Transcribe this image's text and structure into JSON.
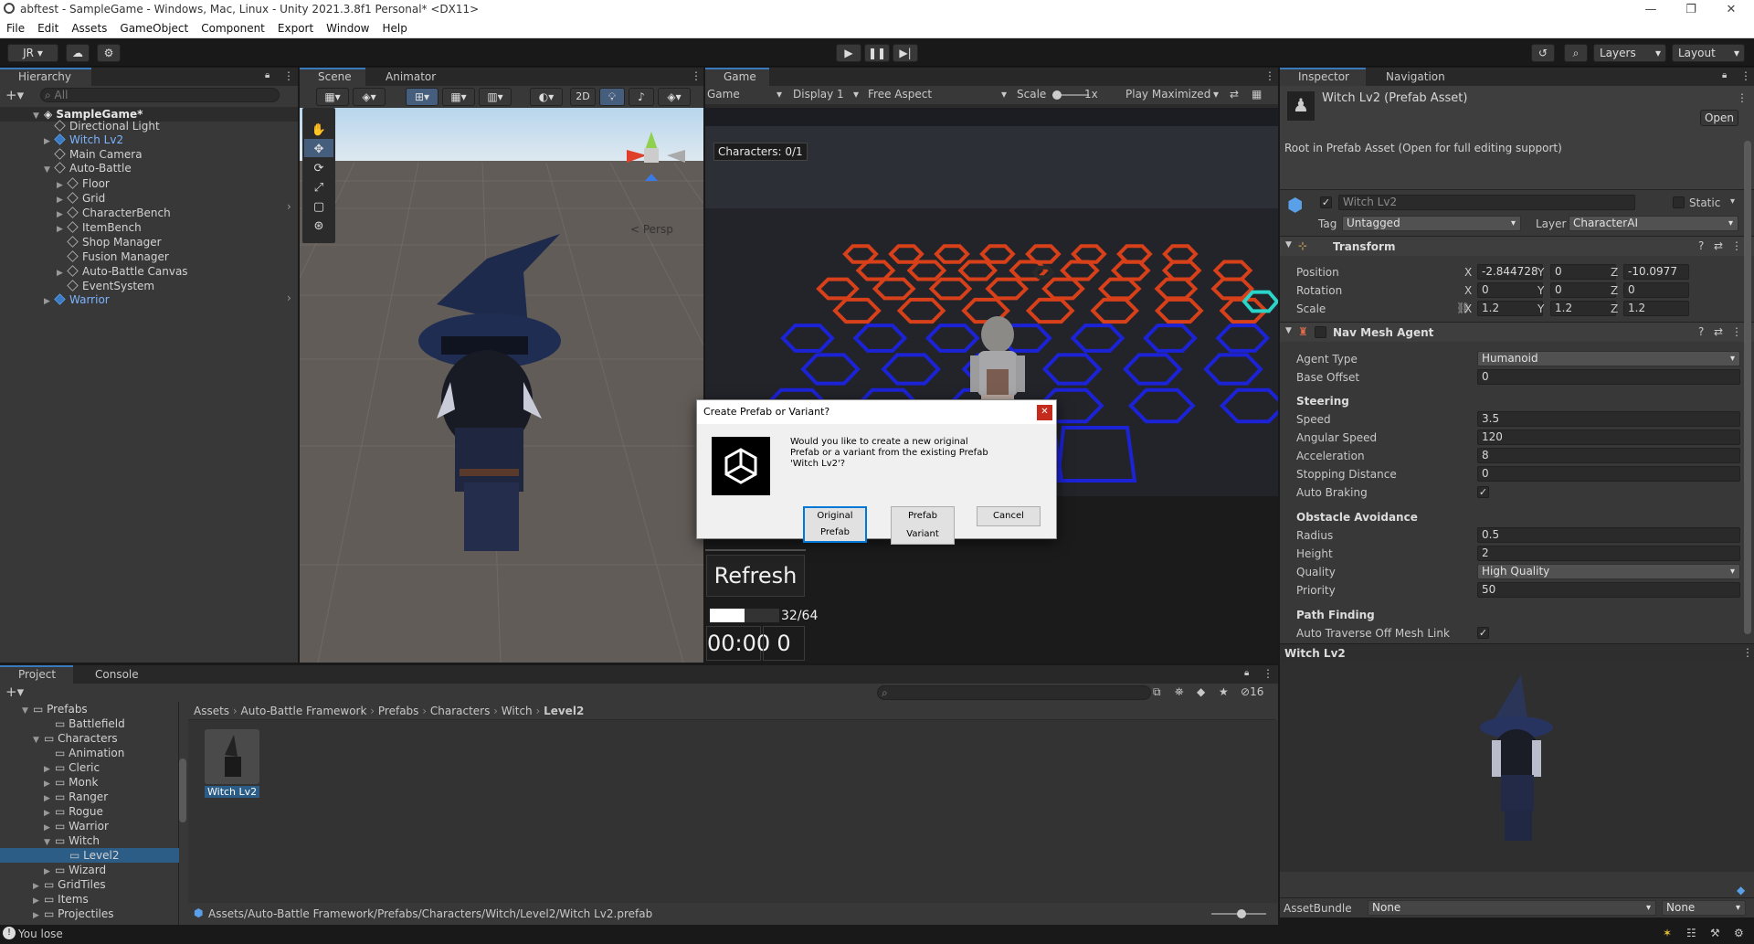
{
  "window": {
    "title": "abftest - SampleGame - Windows, Mac, Linux - Unity 2021.3.8f1 Personal* <DX11>",
    "minimize": "—",
    "maximize": "❐",
    "close": "✕"
  },
  "menu": [
    "File",
    "Edit",
    "Assets",
    "GameObject",
    "Component",
    "Export",
    "Window",
    "Help"
  ],
  "toolbar": {
    "account": "JR",
    "layers": "Layers",
    "layout": "Layout"
  },
  "hierarchy": {
    "tab": "Hierarchy",
    "search_placeholder": "All",
    "items": [
      {
        "label": "SampleGame*"
      },
      {
        "label": "Directional Light"
      },
      {
        "label": "Witch Lv2"
      },
      {
        "label": "Main Camera"
      },
      {
        "label": "Auto-Battle"
      },
      {
        "label": "Floor"
      },
      {
        "label": "Grid"
      },
      {
        "label": "CharacterBench"
      },
      {
        "label": "ItemBench"
      },
      {
        "label": "Shop Manager"
      },
      {
        "label": "Fusion Manager"
      },
      {
        "label": "Auto-Battle Canvas"
      },
      {
        "label": "EventSystem"
      },
      {
        "label": "Warrior"
      }
    ]
  },
  "scene": {
    "tab_scene": "Scene",
    "tab_animator": "Animator",
    "mode_2d": "2D",
    "persp": "< Persp"
  },
  "game": {
    "tab": "Game",
    "display_mode": "Game",
    "display": "Display 1",
    "aspect": "Free Aspect",
    "scale_label": "Scale",
    "scale_value": "1x",
    "play_mode": "Play Maximized",
    "characters": "Characters: 0/1",
    "refresh": "Refresh",
    "xp": "32/64",
    "progress_fraction": 0.5,
    "timer": "00:00",
    "count": "0"
  },
  "dialog": {
    "title": "Create Prefab or Variant?",
    "message": "Would you like to create a new original Prefab or a variant from the existing Prefab 'Witch Lv2'?",
    "btn_original": "Original Prefab",
    "btn_variant": "Prefab Variant",
    "btn_cancel": "Cancel"
  },
  "inspector": {
    "tab_inspector": "Inspector",
    "tab_navigation": "Navigation",
    "asset_title": "Witch Lv2 (Prefab Asset)",
    "open": "Open",
    "root_note": "Root in Prefab Asset (Open for full editing support)",
    "name": "Witch Lv2",
    "static": "Static",
    "tag_label": "Tag",
    "tag_value": "Untagged",
    "layer_label": "Layer",
    "layer_value": "CharacterAI",
    "transform": {
      "header": "Transform",
      "position_label": "Position",
      "rotation_label": "Rotation",
      "scale_label": "Scale",
      "position": [
        "-2.844728",
        "0",
        "-10.0977"
      ],
      "rotation": [
        "0",
        "0",
        "0"
      ],
      "scale": [
        "1.2",
        "1.2",
        "1.2"
      ],
      "axes": [
        "X",
        "Y",
        "Z"
      ]
    },
    "nav": {
      "header": "Nav Mesh Agent",
      "agent_type_label": "Agent Type",
      "agent_type": "Humanoid",
      "base_offset_label": "Base Offset",
      "base_offset": "0",
      "steering": "Steering",
      "speed_label": "Speed",
      "speed": "3.5",
      "angular_label": "Angular Speed",
      "angular": "120",
      "accel_label": "Acceleration",
      "accel": "8",
      "stopping_label": "Stopping Distance",
      "stopping": "0",
      "braking_label": "Auto Braking",
      "obstacle": "Obstacle Avoidance",
      "radius_label": "Radius",
      "radius": "0.5",
      "height_label": "Height",
      "height": "2",
      "quality_label": "Quality",
      "quality": "High Quality",
      "priority_label": "Priority",
      "priority": "50",
      "pathfinding": "Path Finding",
      "auto_traverse_label": "Auto Traverse Off Mesh Link"
    },
    "preview_title": "Witch Lv2",
    "assetbundle_label": "AssetBundle",
    "assetbundle": "None",
    "assetbundle_variant": "None"
  },
  "project": {
    "tab_project": "Project",
    "tab_console": "Console",
    "count": "16",
    "tree": [
      {
        "label": "Prefabs"
      },
      {
        "label": "Battlefield"
      },
      {
        "label": "Characters"
      },
      {
        "label": "Animation"
      },
      {
        "label": "Cleric"
      },
      {
        "label": "Monk"
      },
      {
        "label": "Ranger"
      },
      {
        "label": "Rogue"
      },
      {
        "label": "Warrior"
      },
      {
        "label": "Witch"
      },
      {
        "label": "Level2"
      },
      {
        "label": "Wizard"
      },
      {
        "label": "GridTiles"
      },
      {
        "label": "Items"
      },
      {
        "label": "Projectiles"
      }
    ],
    "breadcrumb": [
      "Assets",
      "Auto-Battle Framework",
      "Prefabs",
      "Characters",
      "Witch",
      "Level2"
    ],
    "asset_label": "Witch Lv2",
    "path": "Assets/Auto-Battle Framework/Prefabs/Characters/Witch/Level2/Witch Lv2.prefab"
  },
  "status": {
    "message": "You lose"
  },
  "colors": {
    "accent": "#3a79bb",
    "red_hex": "#d8401a",
    "blue_hex": "#1c23d6",
    "cyan_hex": "#2ad4c8"
  }
}
